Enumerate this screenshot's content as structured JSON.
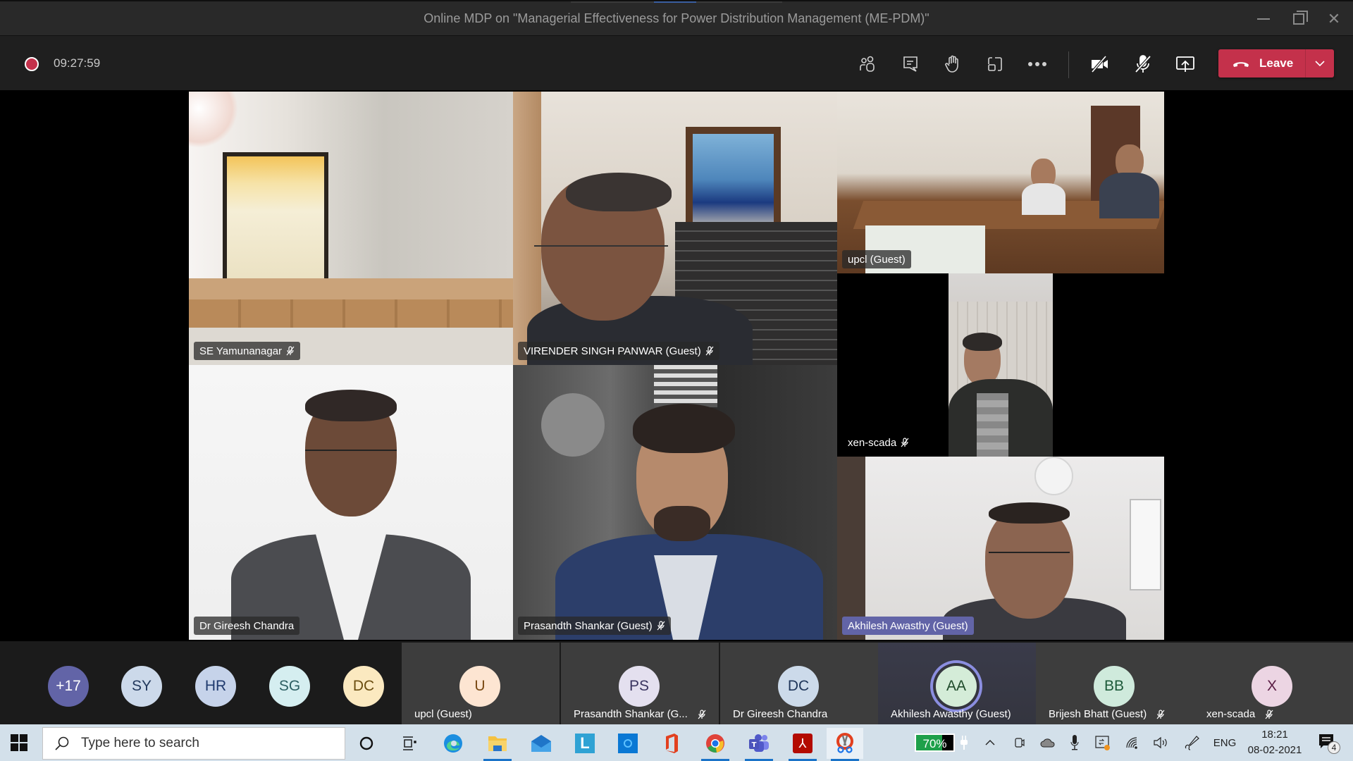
{
  "window": {
    "title": "Online MDP on \"Managerial Effectiveness for Power Distribution Management (ME-PDM)\"",
    "controls": [
      "minimize",
      "restore",
      "close"
    ]
  },
  "toolbar": {
    "recording": true,
    "timer": "09:27:59",
    "icons": [
      "participants-icon",
      "chat-icon",
      "raise-hand-icon",
      "rooms-icon",
      "more-icon",
      "camera-off-icon",
      "mic-off-icon",
      "share-screen-icon"
    ],
    "leave_label": "Leave",
    "colors": {
      "leave": "#c4314b",
      "record": "#c4314b",
      "active_speaker": "#6264a7"
    }
  },
  "videos": [
    {
      "name": "SE Yamunanagar",
      "muted": true,
      "active": false
    },
    {
      "name": "VIRENDER SINGH PANWAR (Guest)",
      "muted": true,
      "active": false
    },
    {
      "name": "upcl (Guest)",
      "muted": false,
      "active": false
    },
    {
      "name": "xen-scada",
      "muted": true,
      "active": false
    },
    {
      "name": "Dr Gireesh Chandra",
      "muted": false,
      "active": false
    },
    {
      "name": "Prasandth Shankar (Guest)",
      "muted": true,
      "active": false
    },
    {
      "name": "Akhilesh Awasthy (Guest)",
      "muted": false,
      "active": true
    }
  ],
  "strip": {
    "overflow": "+17",
    "avatars": [
      {
        "initials": "SY",
        "bg": "#ccd9ea",
        "fg": "#243a5e"
      },
      {
        "initials": "HR",
        "bg": "#c6d3ea",
        "fg": "#1f3a6e"
      },
      {
        "initials": "SG",
        "bg": "#d5eef0",
        "fg": "#2d5f63"
      },
      {
        "initials": "DC",
        "bg": "#fbe9c0",
        "fg": "#6b4d10"
      }
    ],
    "cards": [
      {
        "initials": "U",
        "name": "upcl (Guest)",
        "muted": false,
        "bg": "#fde5d2",
        "fg": "#7a4a14",
        "active": false
      },
      {
        "initials": "PS",
        "name": "Prasandth Shankar (G...",
        "muted": true,
        "bg": "#e4e0ef",
        "fg": "#3a3560",
        "active": false
      },
      {
        "initials": "DC",
        "name": "Dr Gireesh Chandra",
        "muted": false,
        "bg": "#ccdaea",
        "fg": "#1e3559",
        "active": false
      },
      {
        "initials": "AA",
        "name": "Akhilesh Awasthy (Guest)",
        "muted": false,
        "bg": "#d4ecd8",
        "fg": "#1e4a2a",
        "active": true
      },
      {
        "initials": "BB",
        "name": "Brijesh Bhatt (Guest)",
        "muted": true,
        "bg": "#cfeadc",
        "fg": "#1d5a3a",
        "active": false
      },
      {
        "initials": "X",
        "name": "xen-scada",
        "muted": true,
        "bg": "#ecd5e3",
        "fg": "#5a1d44",
        "active": false
      }
    ]
  },
  "taskbar": {
    "search_placeholder": "Type here to search",
    "apps": [
      "cortana-icon",
      "task-view-icon",
      "edge-icon",
      "file-explorer-icon",
      "mail-icon",
      "l-app-icon",
      "cortana-app-icon",
      "office-icon",
      "chrome-icon",
      "teams-icon",
      "acrobat-icon",
      "snipping-tool-icon"
    ],
    "battery_percent": 70,
    "battery_label": "70%",
    "language": "ENG",
    "time": "18:21",
    "date": "08-02-2021",
    "notification_count": "4"
  }
}
